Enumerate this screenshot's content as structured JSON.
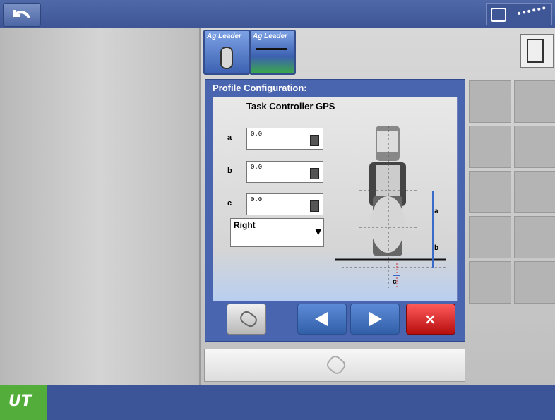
{
  "header": {
    "back_icon": "back-arrow-icon",
    "status_icons": [
      "connection-icon",
      "signal-icon"
    ]
  },
  "tabs": [
    {
      "label": "Ag Leader"
    },
    {
      "label": "Ag Leader"
    }
  ],
  "dialog": {
    "title": "Profile Configuration:",
    "heading": "Task Controller GPS",
    "fields": [
      {
        "label": "a",
        "value": "0.0"
      },
      {
        "label": "b",
        "value": "0.0"
      },
      {
        "label": "c",
        "value": "0.0"
      }
    ],
    "side": "Right"
  },
  "footer": {
    "logo": "UT"
  }
}
